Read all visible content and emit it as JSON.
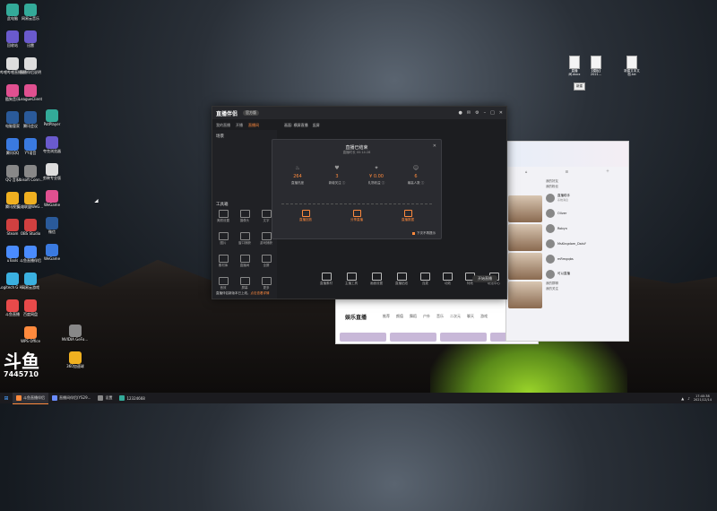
{
  "desktop": {
    "column1": [
      "此电脑",
      "回收站",
      "哔哩哔哩直播姬",
      "酷狗音乐",
      "电脑管家",
      "腾讯QQ",
      "QQ 音乐",
      "腾讯视频",
      "Steam",
      "uTools",
      "Logitech G HUB",
      "斗鱼直播"
    ],
    "column2": [
      "网易云音乐",
      "迅雷",
      "直播伴侣说明",
      "LeagueClient",
      "腾讯会议",
      "YY语音",
      "Ubisoft Connect",
      "英雄联盟WeGame版",
      "OBS Studio",
      "斗鱼直播伴侣",
      "网易云游戏",
      "百度网盘",
      "WPS Office"
    ],
    "column3": [
      "PotPlayer",
      "夸克浏览器",
      "剪映专业版",
      "WeGame",
      "微信",
      "WeGame",
      "",
      "",
      "",
      "",
      "",
      "",
      ""
    ],
    "column4": [
      "",
      "",
      "",
      "",
      "",
      "",
      "NVIDIA GeForce Experience",
      "360加速球",
      "",
      "",
      "",
      "",
      ""
    ],
    "watermark": {
      "title": "斗鱼",
      "room": "7445710"
    },
    "docs": [
      "直播间.docx",
      "【模板】2021...",
      "新建文本文档.txt"
    ],
    "tooltip": "新建"
  },
  "app": {
    "title": "直播伴侣",
    "badge": "官方版",
    "tabs": [
      "我的直播",
      "开播",
      "直播间"
    ],
    "active_tab": "直播间",
    "preview_bar": [
      "画面: 横屏直播",
      "竖屏"
    ],
    "sidebar_sections": [
      "场景",
      "工具箱"
    ],
    "tools": [
      "美颜设置",
      "摄像头",
      "文字",
      "图片",
      "窗口捕获",
      "游戏捕获",
      "素材库",
      "直播间",
      "全屏",
      "音效",
      "屏幕",
      "更多"
    ],
    "bottom_tools": [
      "直播素材",
      "主播工具",
      "画面设置",
      "直播贴纸",
      "连麦",
      "动效",
      "特效",
      "玩法中心"
    ],
    "go_live": "开始直播",
    "notice_text": "直播伴侣新版本已上线，",
    "notice_link": "点击查看详情"
  },
  "modal": {
    "title": "直播已结束",
    "subtitle": "直播时长 00:14:28",
    "stats": [
      {
        "icon": "flame-icon",
        "value": "264",
        "label": "直播热度"
      },
      {
        "icon": "heart-icon",
        "value": "3",
        "label": "新增关注 ⓘ"
      },
      {
        "icon": "gift-icon",
        "value": "¥ 0.00",
        "label": "礼物收益 ⓘ"
      },
      {
        "icon": "user-icon",
        "value": "6",
        "label": "最高人数 ⓘ"
      }
    ],
    "actions": [
      "直播回放",
      "分享直播",
      "直播数据"
    ],
    "checkbox": "下次不再提示"
  },
  "panel": {
    "sections": [
      "我的好友",
      "我的粉丝"
    ],
    "contacts": [
      {
        "name": "直播助手",
        "sub": "系统消息"
      },
      {
        "name": "Oliver",
        "sub": ""
      },
      {
        "name": "Robyn",
        "sub": ""
      },
      {
        "name": "MsKingdom_DaisY",
        "sub": ""
      },
      {
        "name": "mRmgqbs",
        "sub": ""
      },
      {
        "name": "可以直播",
        "sub": ""
      }
    ],
    "footer": [
      "我的群聊",
      "我的关注"
    ]
  },
  "ent": {
    "title": "娱乐直播",
    "nav": [
      "推荐",
      "颜值",
      "舞蹈",
      "户外",
      "音乐",
      "二次元",
      "聊天",
      "游戏"
    ]
  },
  "taskbar": {
    "items": [
      "斗鱼直播伴侣",
      "直播间伴侣(YS29...",
      "设置",
      "12324668"
    ],
    "time": "17:40:38",
    "date": "2021/12/14"
  }
}
